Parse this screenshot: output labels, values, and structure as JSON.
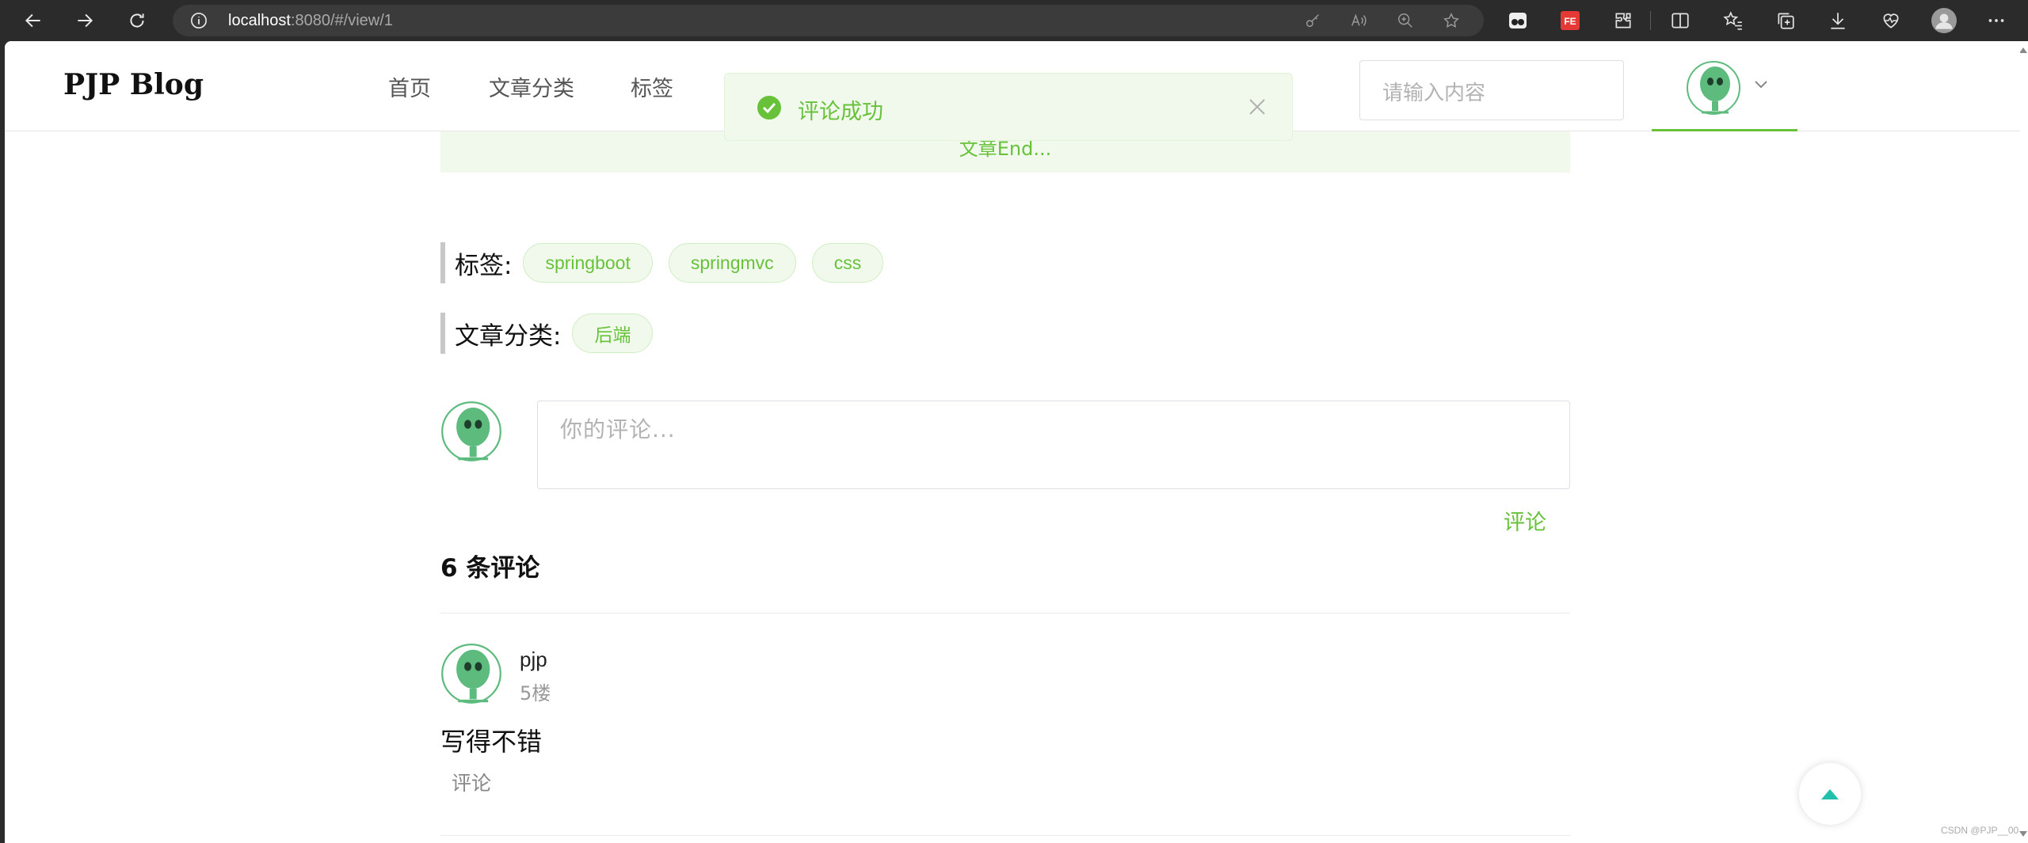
{
  "browser": {
    "url_host": "localhost",
    "url_path": ":8080/#/view/1"
  },
  "header": {
    "logo": "PJP Blog",
    "menu": [
      "首页",
      "文章分类",
      "标签"
    ],
    "search_placeholder": "请输入内容"
  },
  "toast": {
    "message": "评论成功",
    "type": "success",
    "color": "#67c23a"
  },
  "article": {
    "end_text": "文章End...",
    "tags_label": "标签:",
    "tags": [
      "springboot",
      "springmvc",
      "css"
    ],
    "category_label": "文章分类:",
    "categories": [
      "后端"
    ]
  },
  "comment_form": {
    "placeholder": "你的评论...",
    "submit_label": "评论"
  },
  "comments": {
    "count_title": "6 条评论",
    "items": [
      {
        "user": "pjp",
        "floor": "5楼",
        "content": "写得不错",
        "reply_label": "评论"
      }
    ]
  },
  "watermark": "CSDN @PJP__00",
  "colors": {
    "accent": "#67c23a",
    "toast_bg": "#f0f9eb",
    "backtop": "#1fc1ad"
  }
}
